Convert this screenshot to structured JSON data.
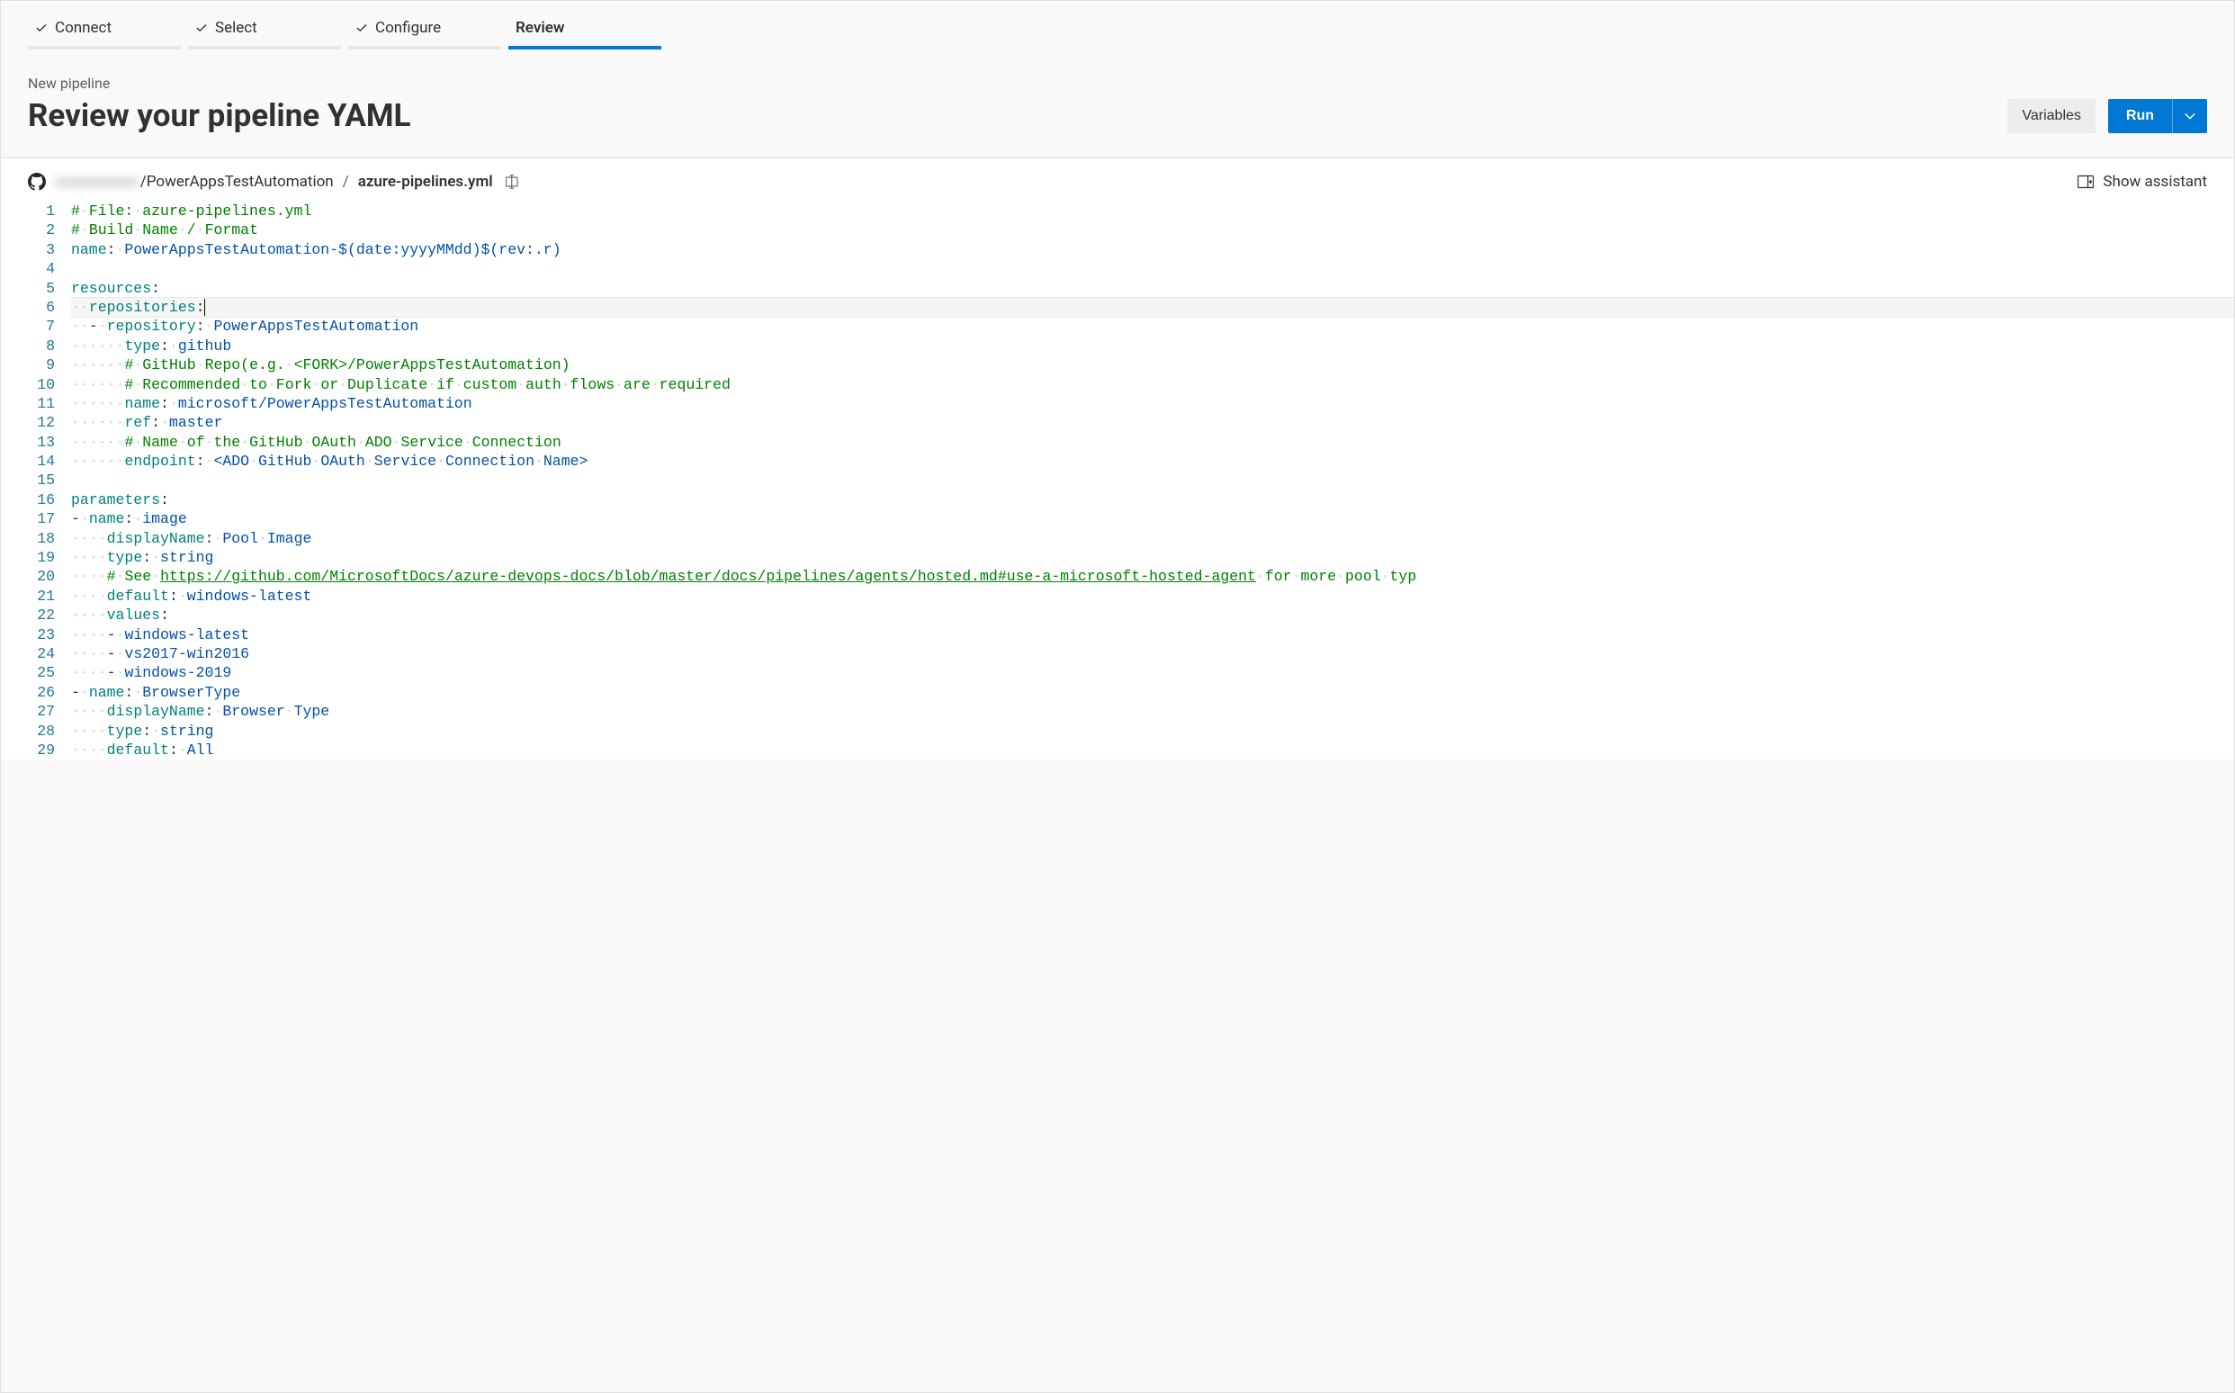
{
  "wizard": {
    "steps": [
      "Connect",
      "Select",
      "Configure",
      "Review"
    ],
    "active_index": 3
  },
  "header": {
    "subtitle": "New pipeline",
    "title": "Review your pipeline YAML"
  },
  "actions": {
    "variables_label": "Variables",
    "run_label": "Run"
  },
  "breadcrumb": {
    "owner_blurred": "xxxxxxxxxxx",
    "repo": "PowerAppsTestAutomation",
    "file": "azure-pipelines.yml"
  },
  "assistant_label": "Show assistant",
  "editor": {
    "current_line": 6,
    "lines": [
      {
        "n": 1,
        "t": "comment",
        "raw": "# File: azure-pipelines.yml"
      },
      {
        "n": 2,
        "t": "comment",
        "raw": "# Build Name / Format"
      },
      {
        "n": 3,
        "t": "kv",
        "k": "name",
        "v": "PowerAppsTestAutomation-$(date:yyyyMMdd)$(rev:.r)"
      },
      {
        "n": 4,
        "t": "blank",
        "raw": ""
      },
      {
        "n": 5,
        "t": "kv",
        "k": "resources",
        "v": ""
      },
      {
        "n": 6,
        "t": "kv",
        "indent": 1,
        "k": "repositories",
        "v": ""
      },
      {
        "n": 7,
        "t": "kv",
        "indent": 2,
        "dash": true,
        "k": "repository",
        "v": "PowerAppsTestAutomation"
      },
      {
        "n": 8,
        "t": "kv",
        "indent": 3,
        "k": "type",
        "v": "github"
      },
      {
        "n": 9,
        "t": "comment",
        "indent": 3,
        "raw": "# GitHub Repo(e.g. <FORK>/PowerAppsTestAutomation)"
      },
      {
        "n": 10,
        "t": "comment",
        "indent": 3,
        "raw": "# Recommended to Fork or Duplicate if custom auth flows are required"
      },
      {
        "n": 11,
        "t": "kv",
        "indent": 3,
        "k": "name",
        "v": "microsoft/PowerAppsTestAutomation"
      },
      {
        "n": 12,
        "t": "kv",
        "indent": 3,
        "k": "ref",
        "v": "master"
      },
      {
        "n": 13,
        "t": "comment",
        "indent": 3,
        "raw": "# Name of the GitHub OAuth ADO Service Connection"
      },
      {
        "n": 14,
        "t": "kv",
        "indent": 3,
        "k": "endpoint",
        "v": "<ADO GitHub OAuth Service Connection Name>"
      },
      {
        "n": 15,
        "t": "blank",
        "raw": ""
      },
      {
        "n": 16,
        "t": "kv",
        "k": "parameters",
        "v": ""
      },
      {
        "n": 17,
        "t": "kv",
        "indent": 1,
        "dash": true,
        "k": "name",
        "v": "image"
      },
      {
        "n": 18,
        "t": "kv",
        "indent": 2,
        "k": "displayName",
        "v": "Pool Image"
      },
      {
        "n": 19,
        "t": "kv",
        "indent": 2,
        "k": "type",
        "v": "string"
      },
      {
        "n": 20,
        "t": "urlcomment",
        "indent": 2,
        "pre": "# See ",
        "url": "https://github.com/MicrosoftDocs/azure-devops-docs/blob/master/docs/pipelines/agents/hosted.md#use-a-microsoft-hosted-agent",
        "post": " for more pool typ"
      },
      {
        "n": 21,
        "t": "kv",
        "indent": 2,
        "k": "default",
        "v": "windows-latest"
      },
      {
        "n": 22,
        "t": "kv",
        "indent": 2,
        "k": "values",
        "v": ""
      },
      {
        "n": 23,
        "t": "item",
        "indent": 2,
        "v": "windows-latest"
      },
      {
        "n": 24,
        "t": "item",
        "indent": 2,
        "v": "vs2017-win2016"
      },
      {
        "n": 25,
        "t": "item",
        "indent": 2,
        "v": "windows-2019"
      },
      {
        "n": 26,
        "t": "kv",
        "indent": 1,
        "dash": true,
        "k": "name",
        "v": "BrowserType"
      },
      {
        "n": 27,
        "t": "kv",
        "indent": 2,
        "k": "displayName",
        "v": "Browser Type"
      },
      {
        "n": 28,
        "t": "kv",
        "indent": 2,
        "k": "type",
        "v": "string"
      },
      {
        "n": 29,
        "t": "kv",
        "indent": 2,
        "k": "default",
        "v": "All"
      }
    ]
  }
}
